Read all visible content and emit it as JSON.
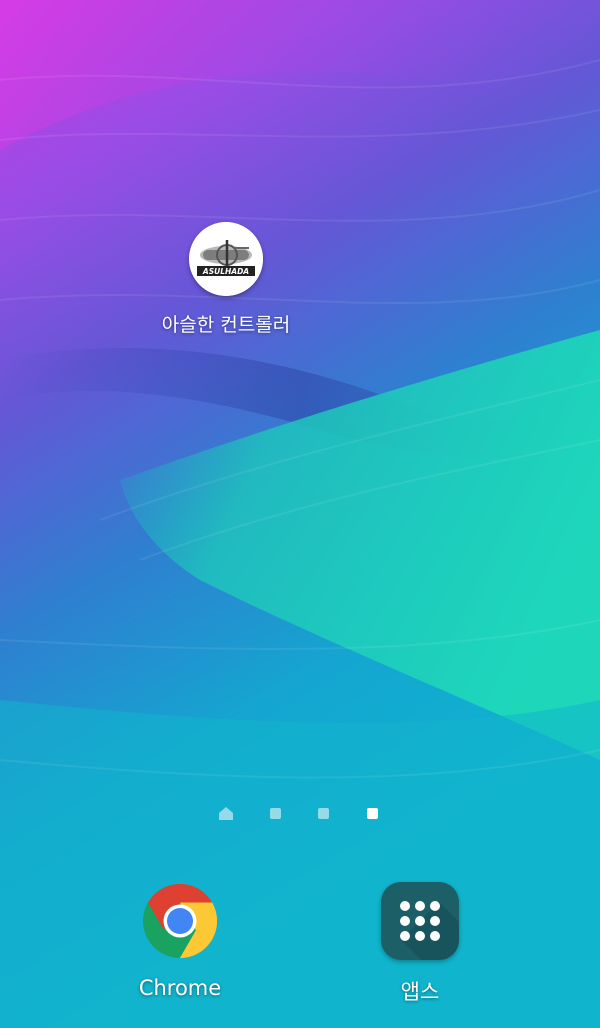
{
  "home_screen": {
    "current_page": 4,
    "page_count": 4
  },
  "apps": [
    {
      "label": "아슬한 컨트롤러",
      "icon": "asulhada-logo-icon",
      "logo_text": "ASULHADA"
    }
  ],
  "dock": {
    "chrome": {
      "label": "Chrome",
      "icon": "chrome-icon"
    },
    "apps": {
      "label": "앱스",
      "icon": "app-grid-icon"
    }
  },
  "colors": {
    "wallpaper_purple": "#b43fe0",
    "wallpaper_violet": "#6a52d8",
    "wallpaper_teal": "#1ec9b8",
    "wallpaper_cyan": "#11b2cf",
    "apps_tile": "#1c5f66"
  }
}
